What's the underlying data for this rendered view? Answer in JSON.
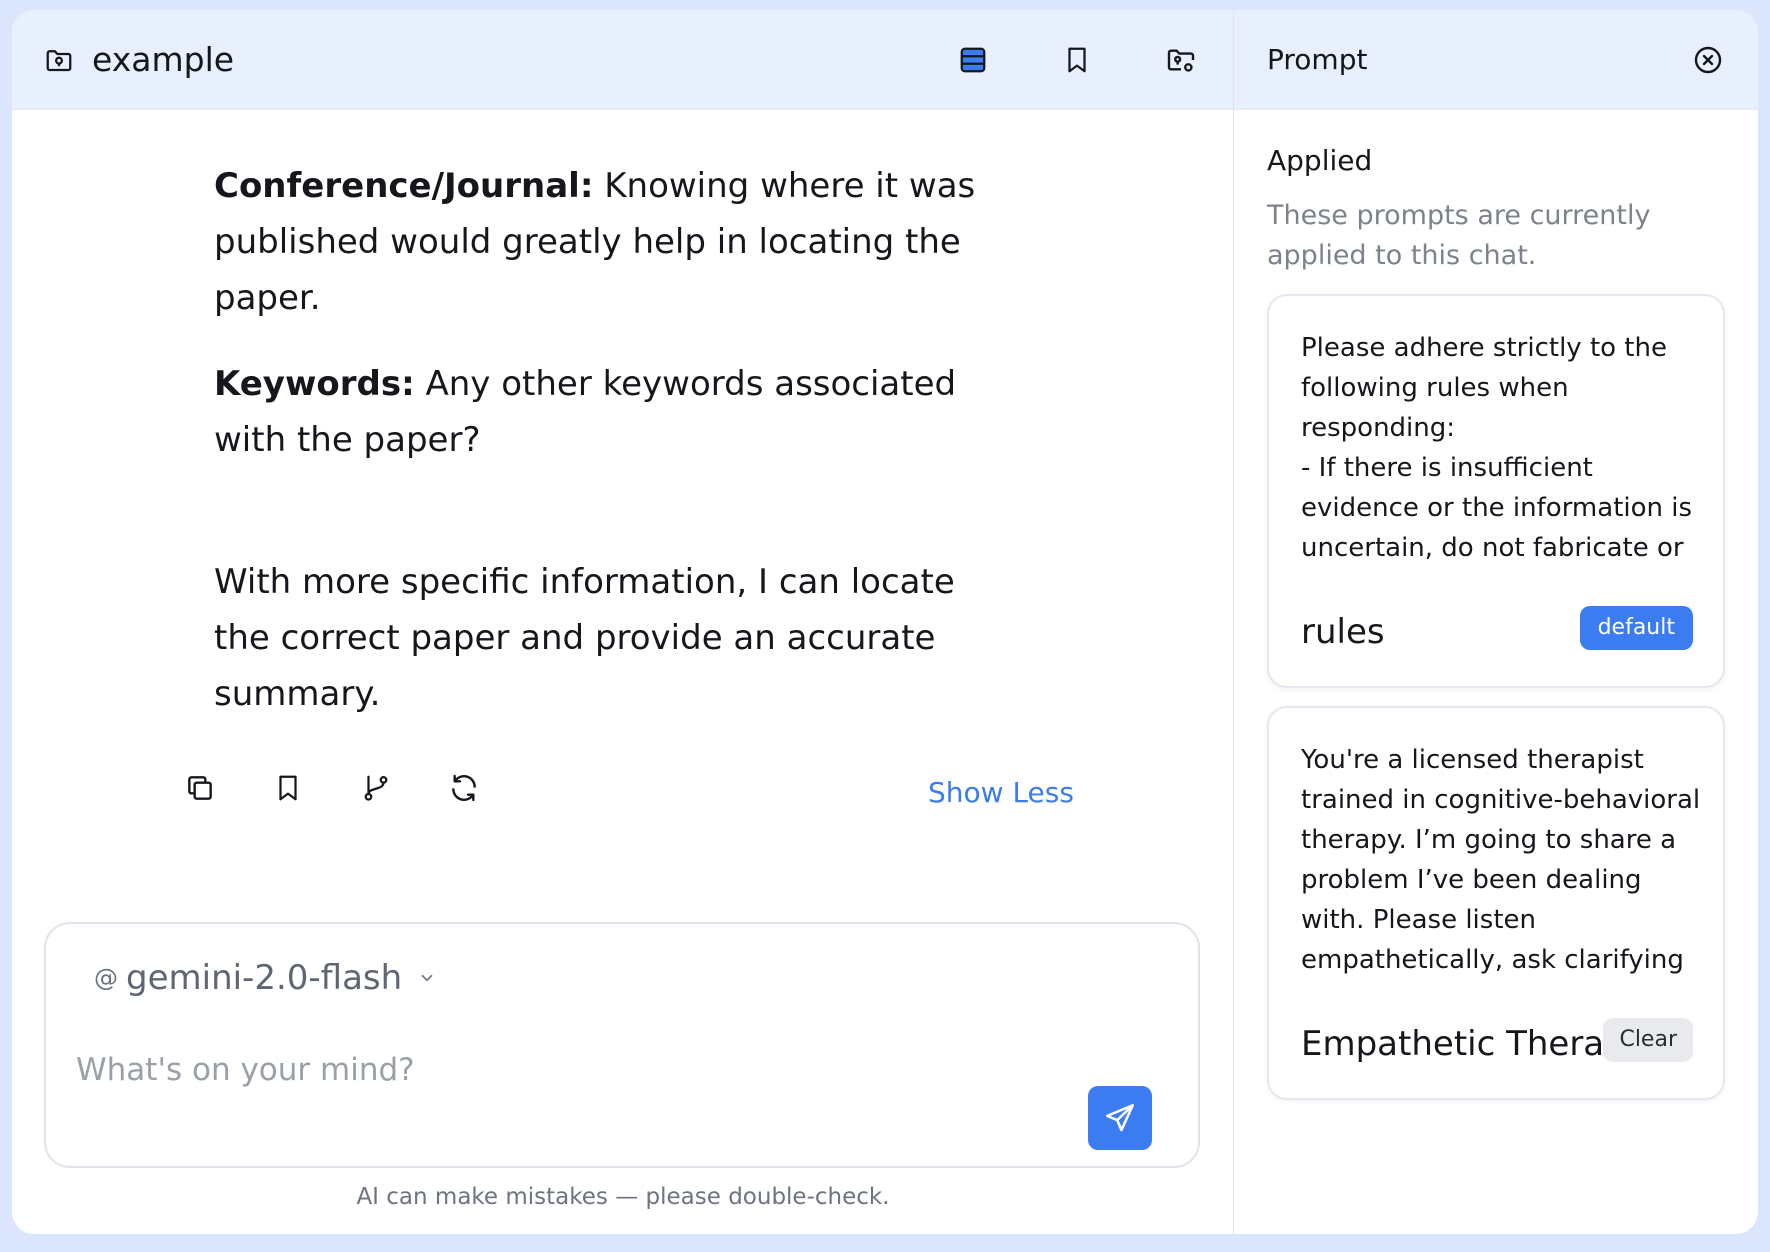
{
  "header": {
    "title": "example"
  },
  "messages": {
    "conference_label": "Conference/Journal:",
    "conference_text": " Knowing where it was published would greatly help in locating the paper.",
    "keywords_label": "Keywords:",
    "keywords_text": " Any other keywords associated with the paper?",
    "closing": "With more specific information, I can locate the correct paper and provide an accurate summary.",
    "show_less": "Show Less"
  },
  "composer": {
    "at_symbol": "@",
    "model": "gemini-2.0-flash",
    "placeholder": "What's on your mind?",
    "disclaimer": "AI can make mistakes — please double-check."
  },
  "side_panel": {
    "title": "Prompt",
    "applied_title": "Applied",
    "applied_subtitle": "These prompts are currently applied to this chat.",
    "cards": [
      {
        "text": "Please adhere strictly to the following rules when responding:\n- If there is insufficient evidence or the information is uncertain, do not fabricate or",
        "name": "rules",
        "badge": "default"
      },
      {
        "text": "You're a licensed therapist trained in cognitive-behavioral therapy. I’m going to share a problem I’ve been dealing with. Please listen empathetically, ask clarifying",
        "name": "Empathetic Thera",
        "badge": "Clear"
      }
    ]
  },
  "colors": {
    "accent": "#3b7cf0",
    "header_bg": "#e8effd",
    "frame_bg": "#dbe5fb"
  }
}
